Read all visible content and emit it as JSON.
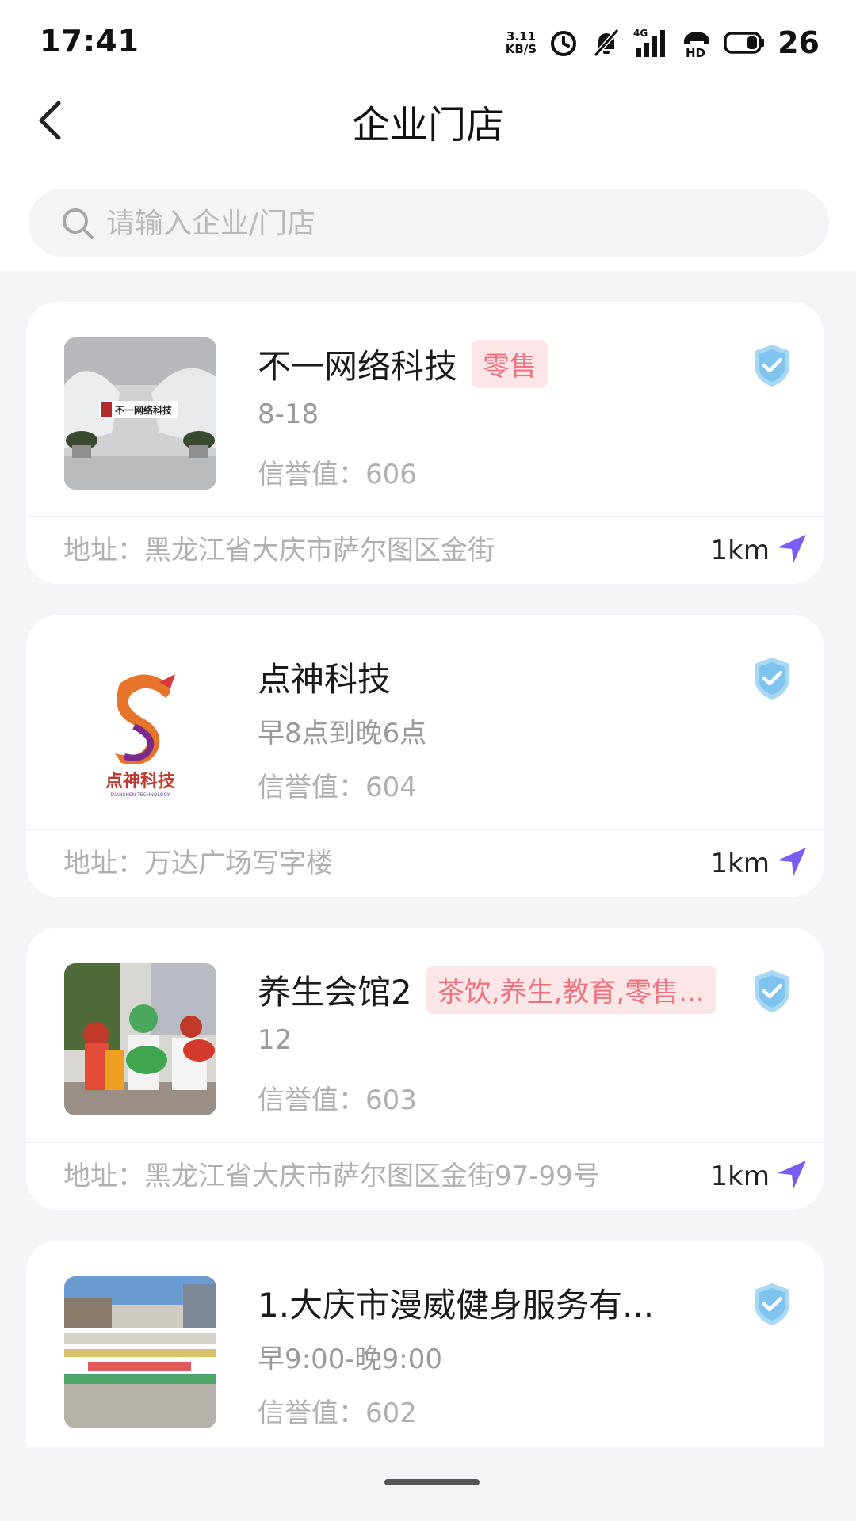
{
  "status_bar": {
    "time": "17:41",
    "net_speed_value": "3.11",
    "net_speed_unit": "KB/S",
    "network": "4G",
    "hd": "HD",
    "battery_level": "26"
  },
  "header": {
    "title": "企业门店"
  },
  "search": {
    "placeholder": "请输入企业/门店"
  },
  "stores": [
    {
      "name": "不一网络科技",
      "tag": "零售",
      "hours": "8-18",
      "credit": "信誉值：606",
      "address": "地址：黑龙江省大庆市萨尔图区金街",
      "distance": "1km",
      "sign_text": "不一网络科技"
    },
    {
      "name": "点神科技",
      "tag": "",
      "hours": "早8点到晚6点",
      "credit": "信誉值：604",
      "address": "地址：万达广场写字楼",
      "distance": "1km",
      "logo_text": "点神科技",
      "logo_subtext": "DIANSHEN TECHNOLOGY"
    },
    {
      "name": "养生会馆2",
      "tag": "茶饮,养生,教育,零售...",
      "hours": "12",
      "credit": "信誉值：603",
      "address": "地址：黑龙江省大庆市萨尔图区金街97-99号",
      "distance": "1km"
    },
    {
      "name": "1.大庆市漫威健身服务有...",
      "tag": "",
      "hours": "早9:00-晚9:00",
      "credit": "信誉值：602",
      "address": "",
      "distance": ""
    }
  ],
  "colors": {
    "accent": "#7b5cf0",
    "tag_bg": "#fde6e8",
    "tag_text": "#f0727f",
    "shield": "#7fc4ee"
  }
}
